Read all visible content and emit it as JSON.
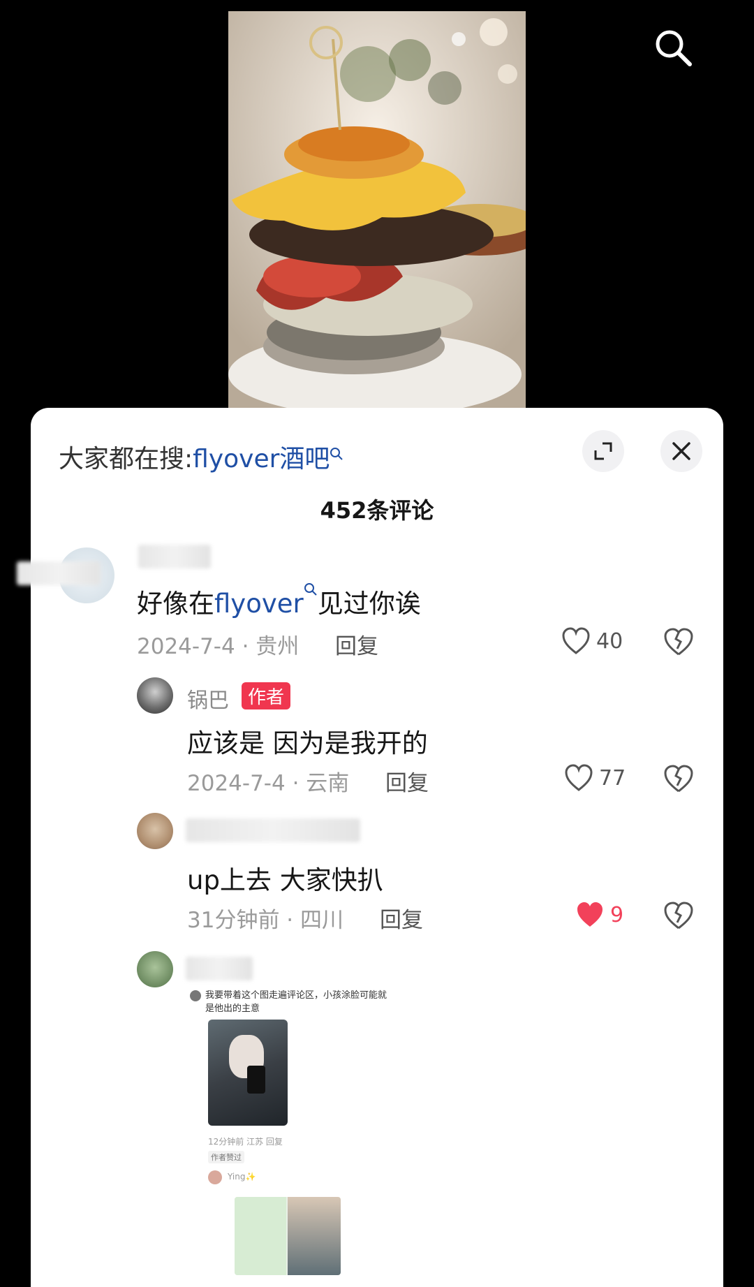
{
  "header": {
    "search_prefix": "大家都在搜:",
    "search_keyword": "flyover酒吧"
  },
  "comments_count": "452条评论",
  "comments": [
    {
      "text_before": "好像在",
      "text_keyword": "flyover",
      "text_after": "见过你诶",
      "meta": "2024-7-4 · 贵州",
      "reply": "回复",
      "likes": "40"
    },
    {
      "username": "锅巴",
      "badge": "作者",
      "text": "应该是 因为是我开的",
      "meta": "2024-7-4 · 云南",
      "reply": "回复",
      "likes": "77"
    },
    {
      "text": "up上去 大家快扒",
      "meta": "31分钟前 · 四川",
      "reply": "回复",
      "likes": "9",
      "liked": true
    }
  ],
  "embedded_screenshot": {
    "text": "我要带着这个图走遍评论区，小孩涂脸可能就是他出的主意",
    "meta": "12分钟前 江苏  回复",
    "tag": "作者赞过",
    "reply_user": "Ying✨"
  },
  "colors": {
    "keyword_blue": "#1f4fa5",
    "like_red": "#f2415a",
    "badge_red": "#f0364f"
  }
}
